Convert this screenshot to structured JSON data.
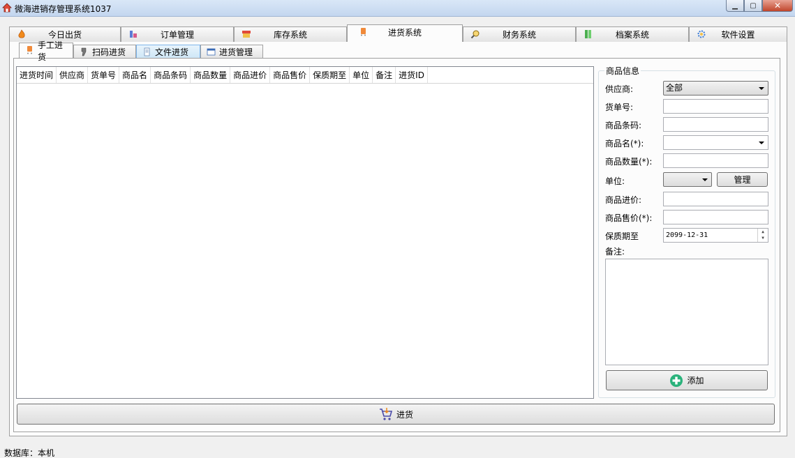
{
  "window": {
    "title": "微海进销存管理系统1037"
  },
  "main_tabs": [
    {
      "label": "今日出货",
      "icon": "fire-icon"
    },
    {
      "label": "订单管理",
      "icon": "order-icon"
    },
    {
      "label": "库存系统",
      "icon": "store-icon"
    },
    {
      "label": "进货系统",
      "icon": "bag-icon",
      "active": true
    },
    {
      "label": "财务系统",
      "icon": "magnifier-icon"
    },
    {
      "label": "档案系统",
      "icon": "archive-icon"
    },
    {
      "label": "软件设置",
      "icon": "gear-icon"
    }
  ],
  "sub_tabs": [
    {
      "label": "手工进货",
      "active": true
    },
    {
      "label": "扫码进货"
    },
    {
      "label": "文件进货"
    },
    {
      "label": "进货管理"
    }
  ],
  "grid": {
    "columns": [
      "进货时间",
      "供应商",
      "货单号",
      "商品名",
      "商品条码",
      "商品数量",
      "商品进价",
      "商品售价",
      "保质期至",
      "单位",
      "备注",
      "进货ID"
    ]
  },
  "form": {
    "group_title": "商品信息",
    "supplier_label": "供应商:",
    "supplier_value": "全部",
    "order_no_label": "货单号:",
    "barcode_label": "商品条码:",
    "name_label": "商品名(*):",
    "qty_label": "商品数量(*):",
    "unit_label": "单位:",
    "manage_button": "管理",
    "cost_label": "商品进价:",
    "price_label": "商品售价(*):",
    "expiry_label": "保质期至",
    "expiry_value": "2099-12-31",
    "note_label": "备注:",
    "add_button": "添加"
  },
  "bottom": {
    "purchase_button": "进货"
  },
  "status": {
    "database": "数据库：本机"
  }
}
